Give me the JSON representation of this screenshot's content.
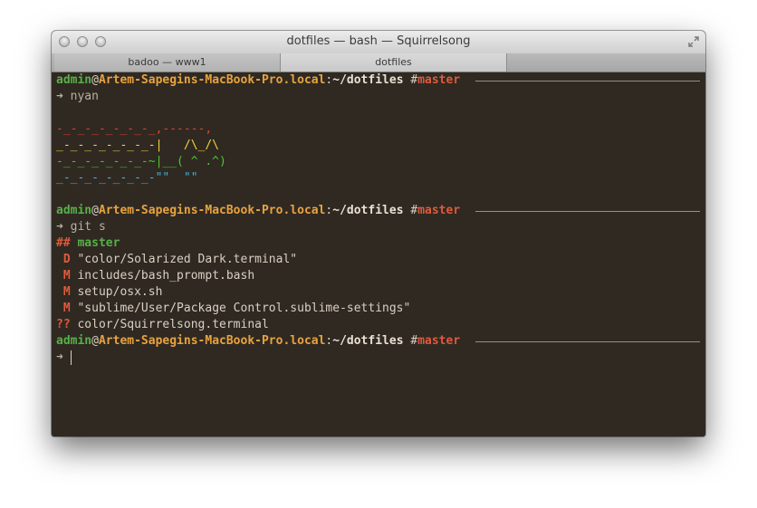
{
  "window": {
    "title": "dotfiles — bash — Squirrelsong"
  },
  "tabs": [
    {
      "label": "badoo — www1"
    },
    {
      "label": "dotfiles"
    }
  ],
  "prompt": {
    "user": "admin",
    "at": "@",
    "host": "Artem-Sapegins-MacBook-Pro.local",
    "colon": ":",
    "path": "~/dotfiles",
    "hash": " #",
    "branch": "master",
    "arrow": "➜"
  },
  "commands": {
    "first": "nyan",
    "second": "git s"
  },
  "nyan": {
    "row1": "-_-_-_-_-_-_-_,------,",
    "row2": "_-_-_-_-_-_-_-|   /\\_/\\",
    "row3": "-_-_-_-_-_-_-~|__( ^ .^)",
    "row4": "_-_-_-_-_-_-_-\"\"  \"\""
  },
  "git_status": {
    "branch_line": {
      "prefix": "##",
      "branch": "master"
    },
    "files": [
      {
        "code": " D",
        "path": "\"color/Solarized Dark.terminal\""
      },
      {
        "code": " M",
        "path": "includes/bash_prompt.bash"
      },
      {
        "code": " M",
        "path": "setup/osx.sh"
      },
      {
        "code": " M",
        "path": "\"sublime/User/Package Control.sublime-settings\""
      },
      {
        "code": "??",
        "path": "color/Squirrelsong.terminal"
      }
    ]
  },
  "colors": {
    "background": "#2f2922",
    "user": "#58b048",
    "host": "#e8a33f",
    "branch": "#e05a3c",
    "rainbow": [
      "#e0412f",
      "#f0d43a",
      "#4cc431",
      "#3eb6e0"
    ]
  }
}
